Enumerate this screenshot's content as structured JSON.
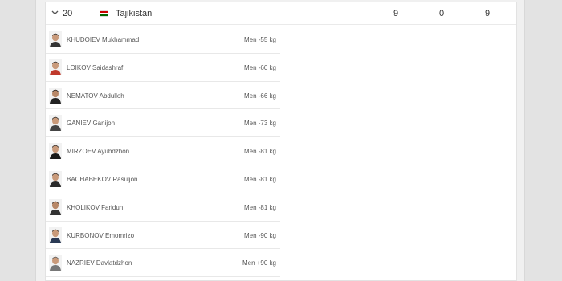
{
  "country": {
    "rank": "20",
    "name": "Tajikistan",
    "flag_icon": "tajikistan-flag-icon",
    "stats": [
      "9",
      "0",
      "9"
    ]
  },
  "athletes": [
    {
      "name": "KHUDOIEV Mukhammad",
      "category": "Men -55 kg"
    },
    {
      "name": "LOIKOV Saidashraf",
      "category": "Men -60 kg"
    },
    {
      "name": "NEMATOV Abdulloh",
      "category": "Men -66 kg"
    },
    {
      "name": "GANIEV Ganijon",
      "category": "Men -73 kg"
    },
    {
      "name": "MIRZOEV Ayubdzhon",
      "category": "Men -81 kg"
    },
    {
      "name": "BACHABEKOV Rasuljon",
      "category": "Men -81 kg"
    },
    {
      "name": "KHOLIKOV Faridun",
      "category": "Men -81 kg"
    },
    {
      "name": "KURBONOV Emomrizo",
      "category": "Men -90 kg"
    },
    {
      "name": "NAZRIEV Davlatdzhon",
      "category": "Men +90 kg"
    }
  ]
}
